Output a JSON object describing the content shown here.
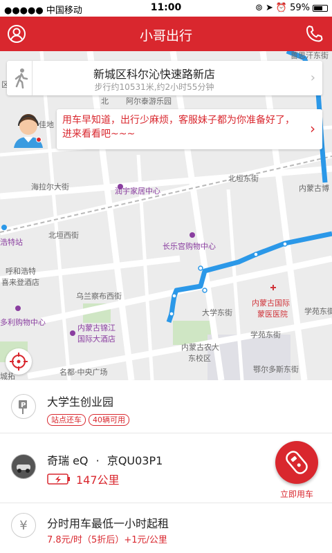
{
  "status": {
    "carrier": "●●●●● 中国移动",
    "time": "11:00",
    "battery": "59%"
  },
  "header": {
    "title": "小哥出行"
  },
  "walk_card": {
    "destination": "新城区科尔沁快速路新店",
    "info": "步行约10531米,约2小时55分钟"
  },
  "bubble": {
    "text": "用车早知道，出行少麻烦，客服妹子都为你准备好了，进来看看吧~~~"
  },
  "map_labels": {
    "l1": "阿尔泰游乐园",
    "l2": "海拉尔大街",
    "l3": "润宇家居中心",
    "l4": "北垣东街",
    "l5": "内蒙古博",
    "l6": "北垣西街",
    "l7": "长乐宫购物中心",
    "l8": "浩特站",
    "l9": "呼和浩特",
    "l10": "喜来登酒店",
    "l11": "乌兰察布西街",
    "l12": "内蒙古国际",
    "l13": "蒙医医院",
    "l14": "多利购物中心",
    "l15": "大学东街",
    "l16": "学苑东街",
    "l17": "内蒙古锦江",
    "l18": "国际大酒店",
    "l19": "学苑东街",
    "l20": "内蒙古农大",
    "l21": "东校区",
    "l22": "名都·中央广场",
    "l23": "鄂尔多斯东街",
    "l24": "佳地",
    "l25": "北",
    "l26": "区",
    "l27": "城拓",
    "l28": "蔷思汗东街"
  },
  "station": {
    "name": "大学生创业园",
    "tags": [
      "站点还车",
      "40辆可用"
    ]
  },
  "car": {
    "model": "奇瑞 eQ",
    "sep": "·",
    "plate": "京QU03P1",
    "range": "147公里"
  },
  "rent_button": {
    "label": "立即用车"
  },
  "pricing": {
    "title": "分时用车最低一小时起租",
    "detail": "7.8元/时（5折后）+1元/公里"
  },
  "colors": {
    "brand": "#d9272e",
    "route": "#2b98e8"
  }
}
